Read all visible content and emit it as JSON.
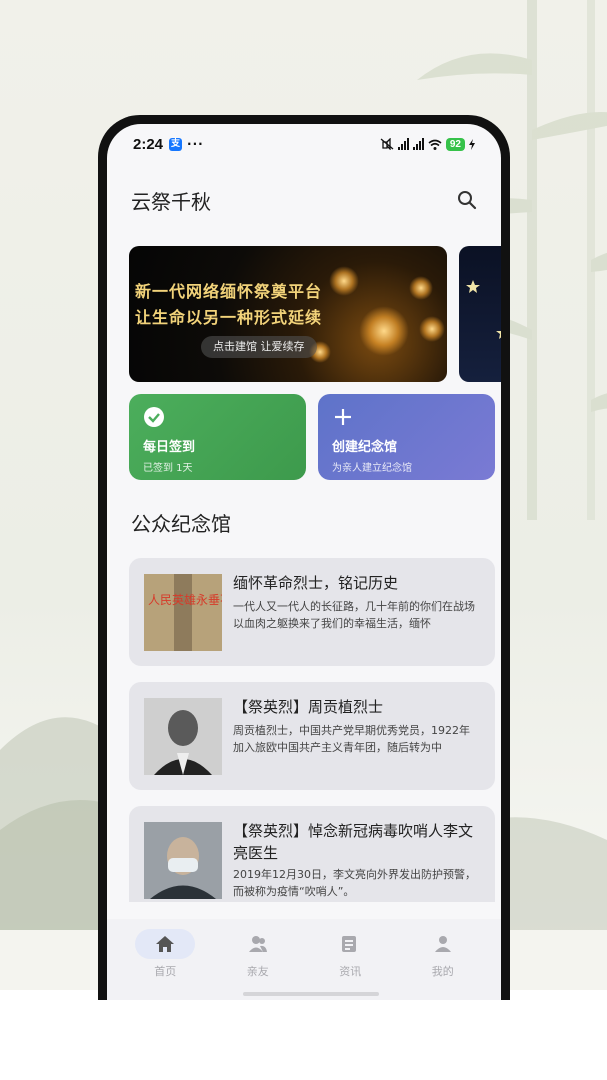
{
  "status_bar": {
    "time": "2:24",
    "app_badge": "支",
    "more": "···",
    "battery": "92"
  },
  "header": {
    "title": "云祭千秋"
  },
  "banner": {
    "line1": "新一代网络缅怀祭奠平台",
    "line2": "让生命以另一种形式延续",
    "cta": "点击建馆  让爱续存"
  },
  "quick_actions": {
    "sign_in": {
      "title": "每日签到",
      "subtitle": "已签到 1天"
    },
    "create": {
      "title": "创建纪念馆",
      "subtitle": "为亲人建立纪念馆"
    }
  },
  "section": {
    "title": "公众纪念馆"
  },
  "memorials": [
    {
      "title": "缅怀革命烈士，铭记历史",
      "desc": "一代人又一代人的长征路，几十年前的你们在战场以血肉之躯换来了我们的幸福生活，缅怀",
      "thumb_text": "人民英雄永垂不朽"
    },
    {
      "title": "【祭英烈】周贡植烈士",
      "desc": "周贡植烈士，中国共产党早期优秀党员，1922年加入旅欧中国共产主义青年团，随后转为中"
    },
    {
      "title": "【祭英烈】悼念新冠病毒吹哨人李文亮医生",
      "desc": "2019年12月30日，李文亮向外界发出防护预警，而被称为疫情“吹哨人”。"
    }
  ],
  "tabs": [
    {
      "label": "首页",
      "icon": "home-icon"
    },
    {
      "label": "亲友",
      "icon": "friends-icon"
    },
    {
      "label": "资讯",
      "icon": "news-icon"
    },
    {
      "label": "我的",
      "icon": "profile-icon"
    }
  ],
  "colors": {
    "sign_card": "#4cae5c",
    "create_card": "#5e73c9",
    "banner_text": "#f2d37a",
    "tab_active_bg": "#e3e8f7"
  }
}
